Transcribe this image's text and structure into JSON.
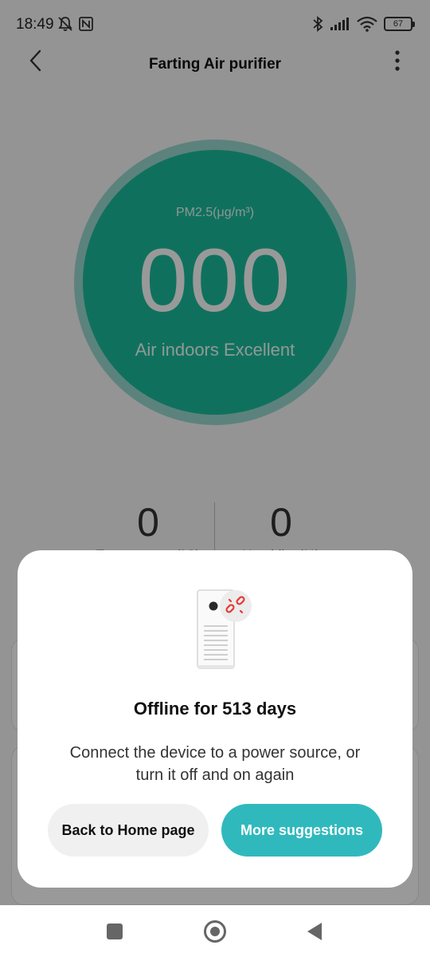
{
  "status_bar": {
    "time": "18:49",
    "battery": "67"
  },
  "header": {
    "title": "Farting Air purifier"
  },
  "pm": {
    "label": "PM2.5(μg/m³)",
    "value": "000",
    "status": "Air indoors Excellent"
  },
  "metrics": {
    "temperature": {
      "value": "0",
      "label": "Temperature (°C)"
    },
    "humidity": {
      "value": "0",
      "label": "Humidity (%)"
    }
  },
  "dialog": {
    "title": "Offline for 513 days",
    "message": "Connect the device to a power source, or turn it off and on again",
    "home_button": "Back to Home page",
    "more_button": "More suggestions"
  },
  "icons": {
    "back": "chevron-left-icon",
    "more": "more-vertical-icon",
    "disconnect": "broken-link-icon"
  },
  "colors": {
    "accent": "#30b9bd",
    "pm_circle": "#1abc9c",
    "disconnect": "#e53935"
  }
}
